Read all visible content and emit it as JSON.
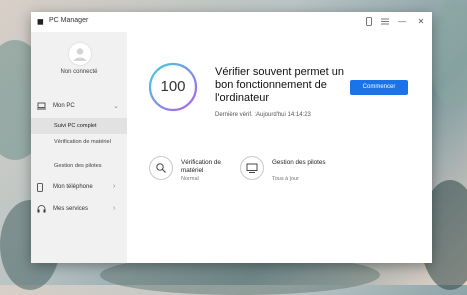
{
  "window": {
    "title": "PC Manager",
    "logo_glyph": "◼"
  },
  "titlebar": {
    "phone_icon": "phone-icon",
    "menu_icon": "menu-icon",
    "minimize_glyph": "—",
    "close_glyph": "✕"
  },
  "sidebar": {
    "user_status": "Non connecté",
    "items": [
      {
        "label": "Mon PC",
        "icon": "laptop-icon",
        "chevron": "⌄"
      },
      {
        "label": "Mon téléphone",
        "icon": "phone-icon",
        "chevron": "›"
      },
      {
        "label": "Mes services",
        "icon": "headset-icon",
        "chevron": "›"
      }
    ],
    "subitems": [
      {
        "label": "Suivi PC complet",
        "active": true
      },
      {
        "label": "Vérification de matériel",
        "active": false
      },
      {
        "label": "Gestion des pilotes",
        "active": false
      }
    ]
  },
  "main": {
    "score": "100",
    "headline": "Vérifier souvent permet un bon fonctionnement de l'ordinateur",
    "last_check": "Dernière vérif. :Aujourd'hui 14:14:23",
    "start_button": "Commencer",
    "cards": [
      {
        "title": "Vérification de matériel",
        "subtitle": "Normal",
        "icon": "hardware-check-icon"
      },
      {
        "title": "Gestion des pilotes",
        "subtitle": "Tous à jour",
        "icon": "driver-management-icon"
      }
    ]
  },
  "colors": {
    "accent": "#1a73e8",
    "sidebar_bg": "#f1f1f1",
    "ring_gradient_start": "#3fd0e0",
    "ring_gradient_end": "#b35de8"
  }
}
